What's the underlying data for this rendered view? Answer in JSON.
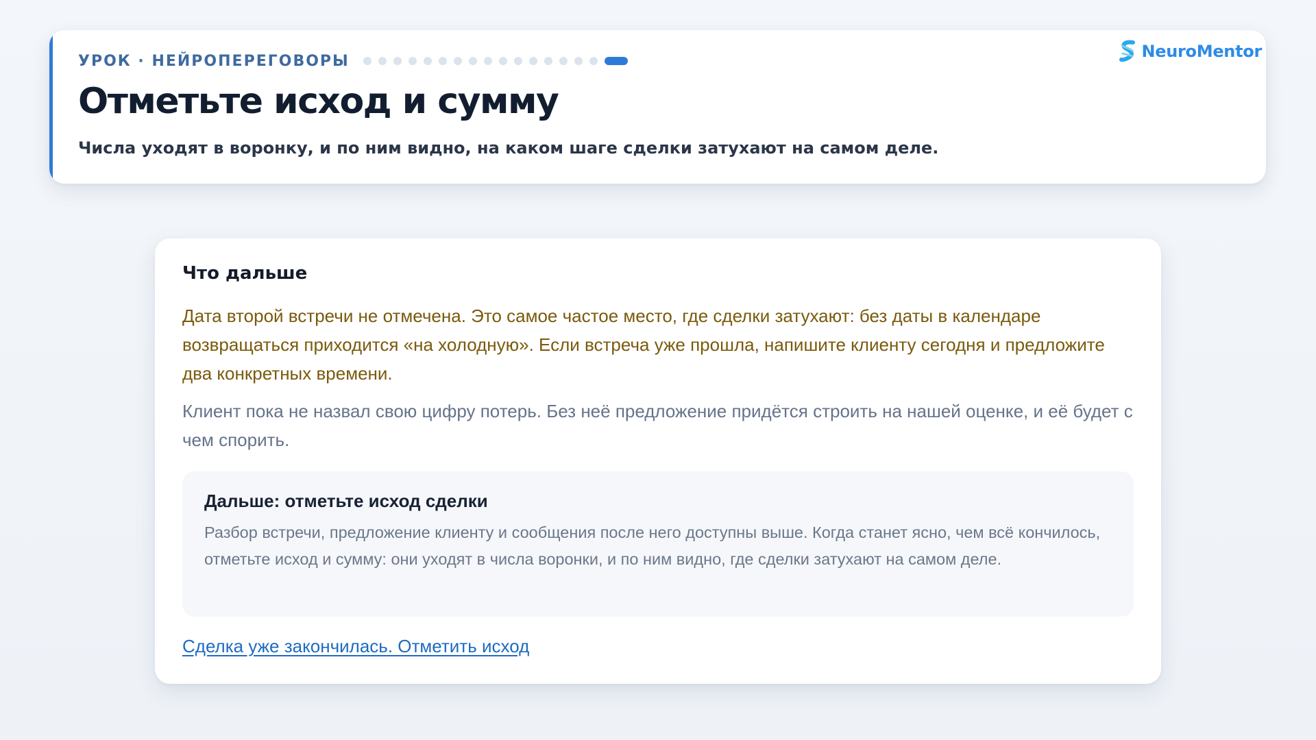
{
  "header": {
    "eyebrow": "УРОК · НЕЙРОПЕРЕГОВОРЫ",
    "progress": {
      "total_steps": 17,
      "current_step": 17
    },
    "title": "Отметьте исход и сумму",
    "subtitle": "Числа уходят в воронку, и по ним видно, на каком шаге сделки затухают на самом деле."
  },
  "brand": {
    "name": "NeuroMentor",
    "icon": "neuromentor-logo-icon",
    "color": "#2e8be6"
  },
  "card": {
    "title": "Что дальше",
    "warning": "Дата второй встречи не отмечена. Это самое частое место, где сделки затухают: без даты в календаре возвращаться приходится «на холодную». Если встреча уже прошла, напишите клиенту сегодня и предложите два конкретных времени.",
    "info": "Клиент пока не назвал свою цифру потерь. Без неё предложение придётся строить на нашей оценке, и её будет с чем спорить.",
    "next_step": {
      "title": "Дальше: отметьте исход сделки",
      "text": "Разбор встречи, предложение клиенту и сообщения после него доступны выше. Когда станет ясно, чем всё кончилось, отметьте исход и сумму: они уходят в числа воронки, и по ним видно, где сделки затухают на самом деле."
    },
    "action_link": "Сделка уже закончилась. Отметить исход"
  },
  "colors": {
    "accent": "#2e7ad8",
    "warning_text": "#7a5a0c",
    "muted_text": "#65738a",
    "link": "#1e6bc0"
  }
}
